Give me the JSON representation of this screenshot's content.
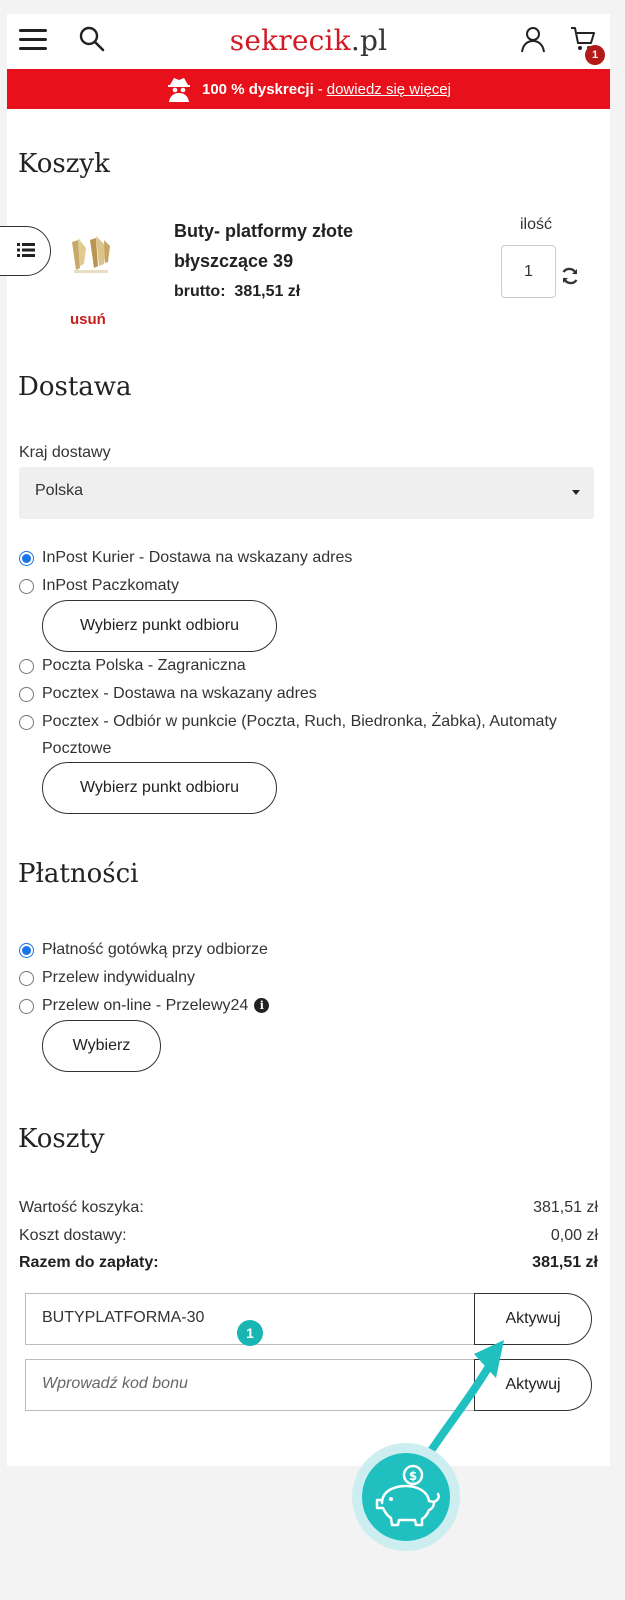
{
  "header": {
    "logo_main": "sekrecik",
    "logo_tld": ".pl",
    "cart_count": "1",
    "icons": [
      "menu-icon",
      "search-icon",
      "user-icon",
      "cart-icon"
    ]
  },
  "banner": {
    "text": "100 % dyskrecji",
    "separator": "-",
    "link": "dowiedz się więcej"
  },
  "cart": {
    "title": "Koszyk",
    "product_name": "Buty- platformy złote błyszczące 39",
    "price_label": "brutto:",
    "price": "381,51 zł",
    "remove": "usuń",
    "qty_label": "ilość",
    "qty": "1"
  },
  "delivery": {
    "title": "Dostawa",
    "country_label": "Kraj dostawy",
    "country": "Polska",
    "options": [
      "InPost Kurier - Dostawa na wskazany adres",
      "InPost Paczkomaty",
      "Poczta Polska - Zagraniczna",
      "Pocztex - Dostawa na wskazany adres",
      "Pocztex - Odbiór w punkcie (Poczta, Ruch, Biedronka, Żabka), Automaty Pocztowe"
    ],
    "selected": 0,
    "pickup_button": "Wybierz punkt odbioru"
  },
  "payment": {
    "title": "Płatności",
    "options": [
      "Płatność gotówką przy odbiorze",
      "Przelew indywidualny",
      "Przelew on-line - Przelewy24"
    ],
    "selected": 0,
    "choose_button": "Wybierz"
  },
  "costs": {
    "title": "Koszty",
    "rows": [
      {
        "label": "Wartość koszyka:",
        "value": "381,51 zł"
      },
      {
        "label": "Koszt dostawy:",
        "value": "0,00 zł"
      },
      {
        "label": "Razem do zapłaty:",
        "value": "381,51 zł"
      }
    ],
    "coupon_value": "BUTYPLATFORMA-30",
    "voucher_placeholder": "Wprowadź kod bonu",
    "activate": "Aktywuj"
  },
  "overlay": {
    "step": "1",
    "accent": "#18b5b2"
  },
  "colors": {
    "brand": "#e8111b",
    "logo": "#d11a24",
    "radio_selected": "#1a73e8",
    "remove": "#c9201e"
  }
}
